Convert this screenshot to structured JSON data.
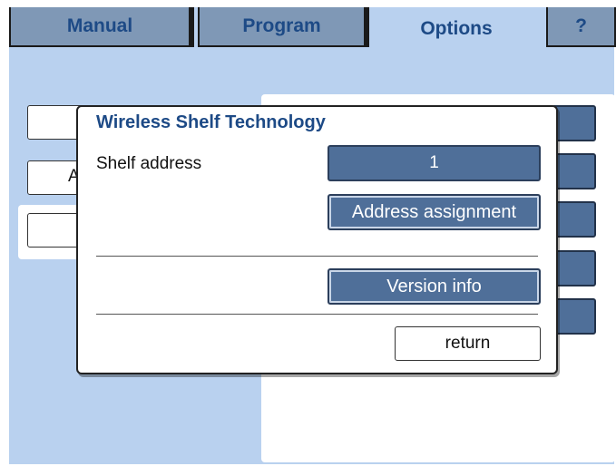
{
  "tabs": [
    {
      "label": "Manual"
    },
    {
      "label": "Program"
    },
    {
      "label": "Options"
    },
    {
      "label": "?"
    }
  ],
  "background": {
    "partial_letter": "A"
  },
  "dialog": {
    "title": "Wireless Shelf Technology",
    "shelf_address_label": "Shelf address",
    "shelf_address_value": "1",
    "address_assignment_label": "Address assignment",
    "version_info_label": "Version info",
    "return_label": "return"
  },
  "colors": {
    "screen_bg": "#b9d1ef",
    "accent_blue": "#4f6f99",
    "title_text": "#1d4a86"
  }
}
